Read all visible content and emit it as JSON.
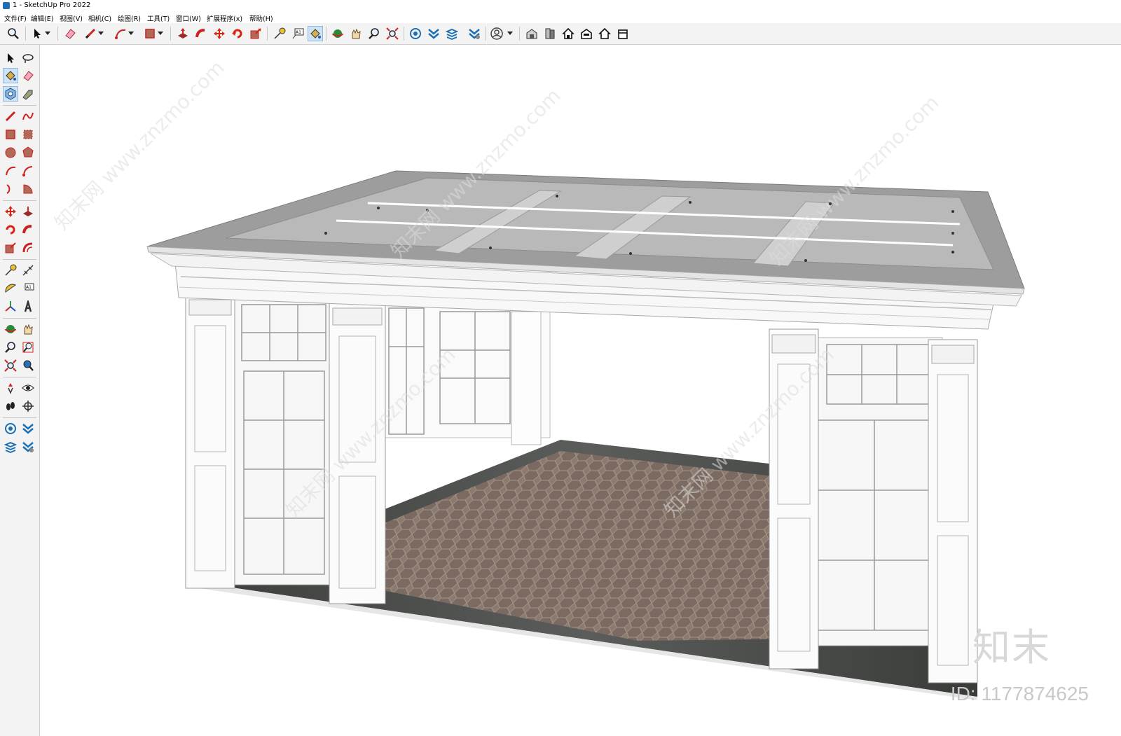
{
  "window": {
    "title": "1 - SketchUp Pro 2022"
  },
  "menu": {
    "file": "文件(F)",
    "edit": "编辑(E)",
    "view": "视图(V)",
    "camera": "相机(C)",
    "draw": "绘图(R)",
    "tools": "工具(T)",
    "window": "窗口(W)",
    "extensions": "扩展程序(x)",
    "help": "帮助(H)"
  },
  "watermark": {
    "logo": "知末",
    "id": "ID: 1177874625",
    "diagonal": "知末网 www.znzmo.com"
  },
  "colors": {
    "selected_tool": "#cde3f7",
    "toolbar_bg": "#f3f3f3",
    "floor_tile": "#7a6a62",
    "roof_glass": "#b9b9b9",
    "base_stone": "#4a4d4a"
  },
  "icons": {
    "top": [
      "zoom-icon",
      "select-icon",
      "dropdown-icon",
      "eraser-icon",
      "pencil-icon",
      "dropdown-icon",
      "arc-icon",
      "dropdown-icon",
      "rectangle-icon",
      "dropdown-icon",
      "push-pull-icon",
      "follow-me-icon",
      "move-icon",
      "rotate-icon",
      "scale-icon",
      "tape-measure-icon",
      "text-icon",
      "paint-bucket-icon",
      "orbit-icon",
      "pan-icon",
      "zoom-icon",
      "zoom-extents-icon",
      "warehouse-icon",
      "extension-warehouse-icon",
      "layout-icon",
      "extension-manager-icon",
      "account-icon",
      "dropdown-icon",
      "model-info-icon",
      "components-icon",
      "house-icon",
      "house-section-icon",
      "house-outline-icon",
      "house-open-icon"
    ]
  }
}
